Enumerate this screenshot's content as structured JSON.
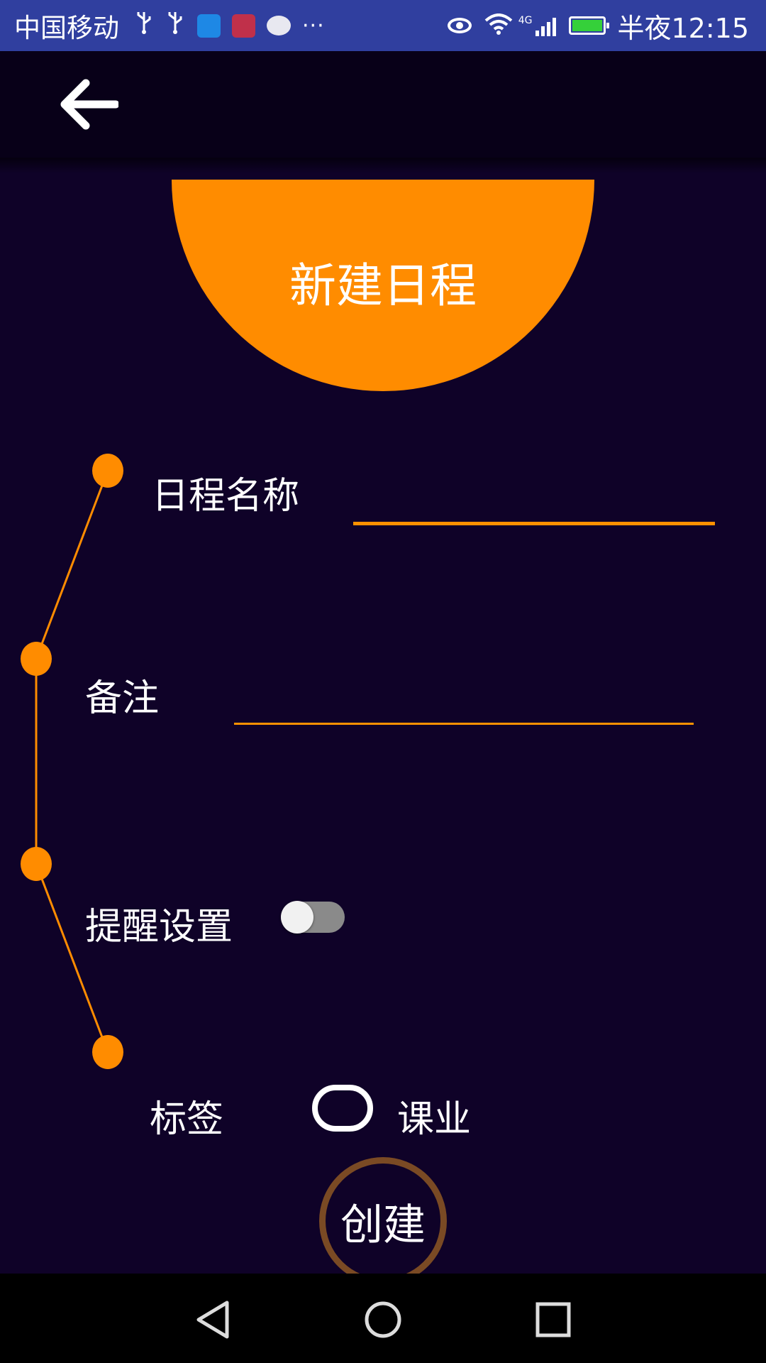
{
  "status_bar": {
    "carrier": "中国移动",
    "network_type": "4G",
    "time": "半夜12:15",
    "more": "···"
  },
  "toolbar": {
    "back_icon": "arrow-left-icon"
  },
  "header": {
    "title": "新建日程"
  },
  "form": {
    "name_label": "日程名称",
    "name_value": "",
    "note_label": "备注",
    "note_value": "",
    "reminder_label": "提醒设置",
    "reminder_enabled": false,
    "tag_label": "标签",
    "tag_option": "课业"
  },
  "actions": {
    "create_label": "创建"
  },
  "colors": {
    "background": "#0f0228",
    "accent": "#ff8c00",
    "status_bar": "#303f9f",
    "toolbar": "#080018",
    "create_ring": "#7a4a24"
  },
  "nav_bar": {
    "back_icon": "triangle-back-icon",
    "home_icon": "circle-home-icon",
    "recents_icon": "square-recents-icon"
  }
}
